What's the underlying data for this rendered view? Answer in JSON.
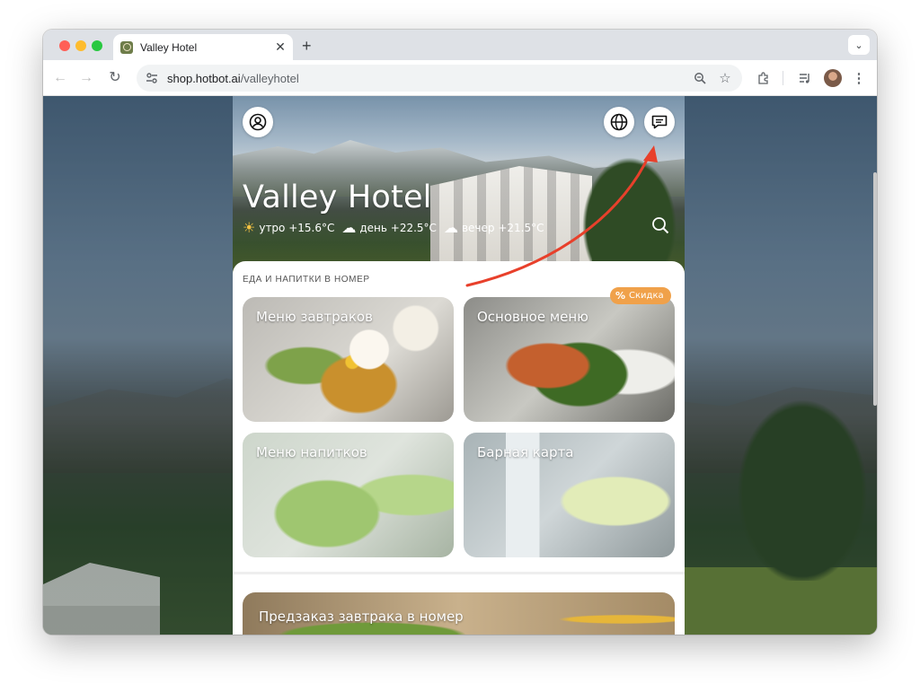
{
  "browser": {
    "tab_title": "Valley Hotel",
    "tab_close": "✕",
    "new_tab": "+",
    "tab_menu": "⌄",
    "url_host": "shop.hotbot.ai",
    "url_path": "/valleyhotel",
    "nav_back": "←",
    "nav_forward": "→",
    "nav_reload": "↻",
    "zoom_icon": "zoom-icon",
    "bookmark": "☆",
    "kebab": "⋮"
  },
  "hero": {
    "title": "Valley Hotel",
    "weather": [
      {
        "icon": "sun-icon",
        "glyph": "☀",
        "text": "утро +15.6°C"
      },
      {
        "icon": "rain-cloud-icon",
        "glyph": "☁",
        "text": "день +22.5°C"
      },
      {
        "icon": "rain-cloud-icon",
        "glyph": "☁",
        "text": "вечер +21.5°C"
      }
    ]
  },
  "section": {
    "title": "ЕДА И НАПИТКИ В НОМЕР"
  },
  "cards": [
    {
      "label": "Меню завтраков"
    },
    {
      "label": "Основное меню"
    },
    {
      "label": "Меню напитков"
    },
    {
      "label": "Барная карта"
    }
  ],
  "badge": {
    "icon": "%",
    "text": "Скидка"
  },
  "wide_card": {
    "label": "Предзаказ завтрака в номер"
  },
  "colors": {
    "accent_badge": "#f0a14a",
    "arrow": "#e8402b"
  }
}
